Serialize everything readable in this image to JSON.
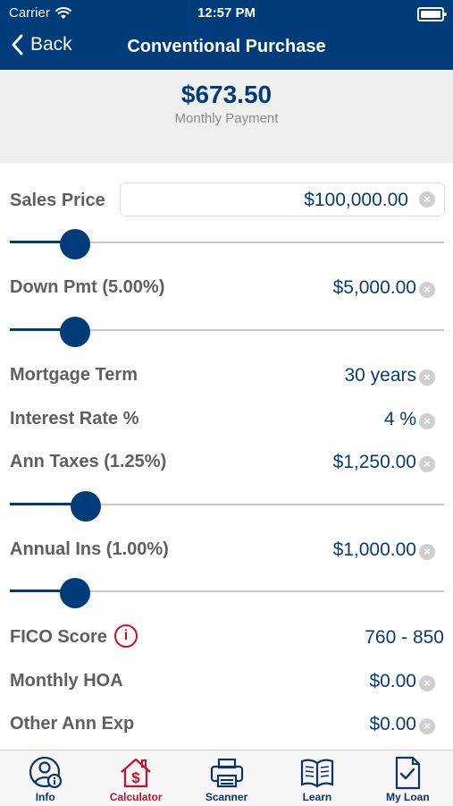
{
  "status": {
    "carrier": "Carrier",
    "time": "12:57 PM"
  },
  "nav": {
    "back_label": "Back",
    "title": "Conventional Purchase"
  },
  "summary": {
    "amount": "$673.50",
    "label": "Monthly Payment"
  },
  "fields": {
    "sales_price": {
      "label": "Sales Price",
      "value": "$100,000.00",
      "slider_level": 0.15
    },
    "down_pmt": {
      "label": "Down Pmt (5.00%)",
      "value": "$5,000.00",
      "slider_level": 0.15
    },
    "mortgage_term": {
      "label": "Mortgage Term",
      "value": "30 years"
    },
    "interest_rate": {
      "label": "Interest Rate %",
      "value": "4 %"
    },
    "ann_taxes": {
      "label": "Ann Taxes (1.25%)",
      "value": "$1,250.00",
      "slider_level": 0.175
    },
    "annual_ins": {
      "label": "Annual Ins (1.00%)",
      "value": "$1,000.00",
      "slider_level": 0.15
    },
    "fico_score": {
      "label": "FICO Score",
      "value": "760 - 850",
      "info_glyph": "i"
    },
    "monthly_hoa": {
      "label": "Monthly HOA",
      "value": "$0.00"
    },
    "other_ann_exp": {
      "label": "Other Ann Exp",
      "value": "$0.00"
    }
  },
  "clear_glyph": "×",
  "tabs": [
    {
      "label": "Info",
      "icon": "user-info-icon"
    },
    {
      "label": "Calculator",
      "icon": "house-dollar-icon",
      "active": true
    },
    {
      "label": "Scanner",
      "icon": "printer-icon"
    },
    {
      "label": "Learn",
      "icon": "book-icon"
    },
    {
      "label": "My Loan",
      "icon": "checklist-icon"
    }
  ],
  "colors": {
    "brand": "#003b7a",
    "accent": "#c8102e",
    "background": "#efefef"
  }
}
